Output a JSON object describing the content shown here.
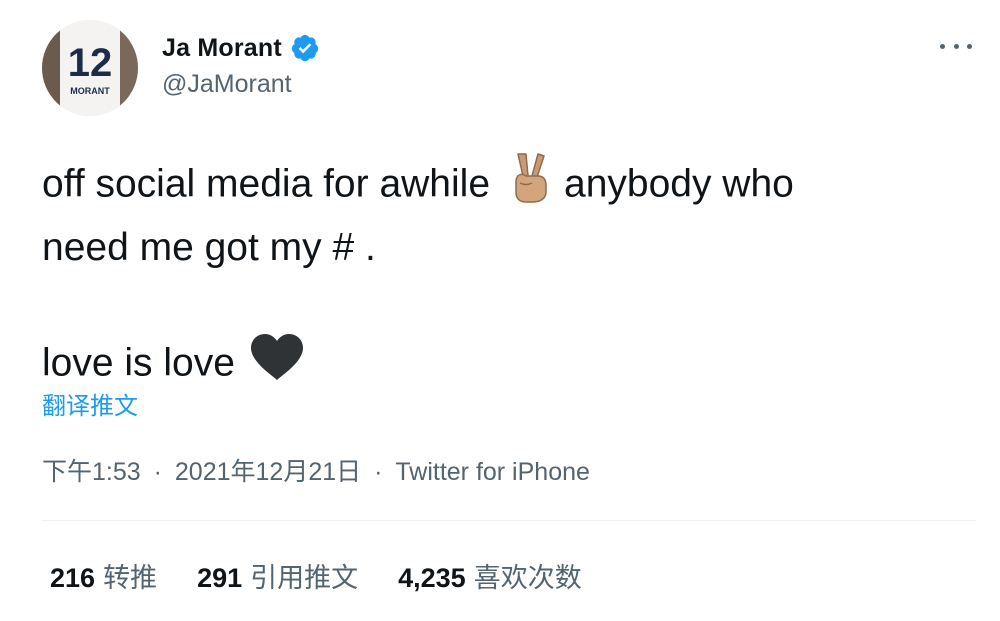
{
  "author": {
    "display_name": "Ja Morant",
    "handle": "@JaMorant",
    "avatar_jersey_number": "12",
    "avatar_jersey_name": "MORANT",
    "verified_color": "#1d9bf0"
  },
  "tweet": {
    "line1_a": "off social media for awhile",
    "line1_emoji": "victory-hand-emoji",
    "line1_b": "anybody who",
    "line2": "need me got my # .",
    "line3": "love is love",
    "line3_emoji": "black-heart-emoji",
    "translate_label": "翻译推文"
  },
  "meta": {
    "time": "下午1:53",
    "date": "2021年12月21日",
    "source": "Twitter for iPhone",
    "separator": "·"
  },
  "stats": {
    "retweets_count": "216",
    "retweets_label": "转推",
    "quotes_count": "291",
    "quotes_label": "引用推文",
    "likes_count": "4,235",
    "likes_label": "喜欢次数"
  },
  "colors": {
    "accent": "#1d9bf0",
    "text_primary": "#0f1419",
    "text_secondary": "#536471"
  }
}
